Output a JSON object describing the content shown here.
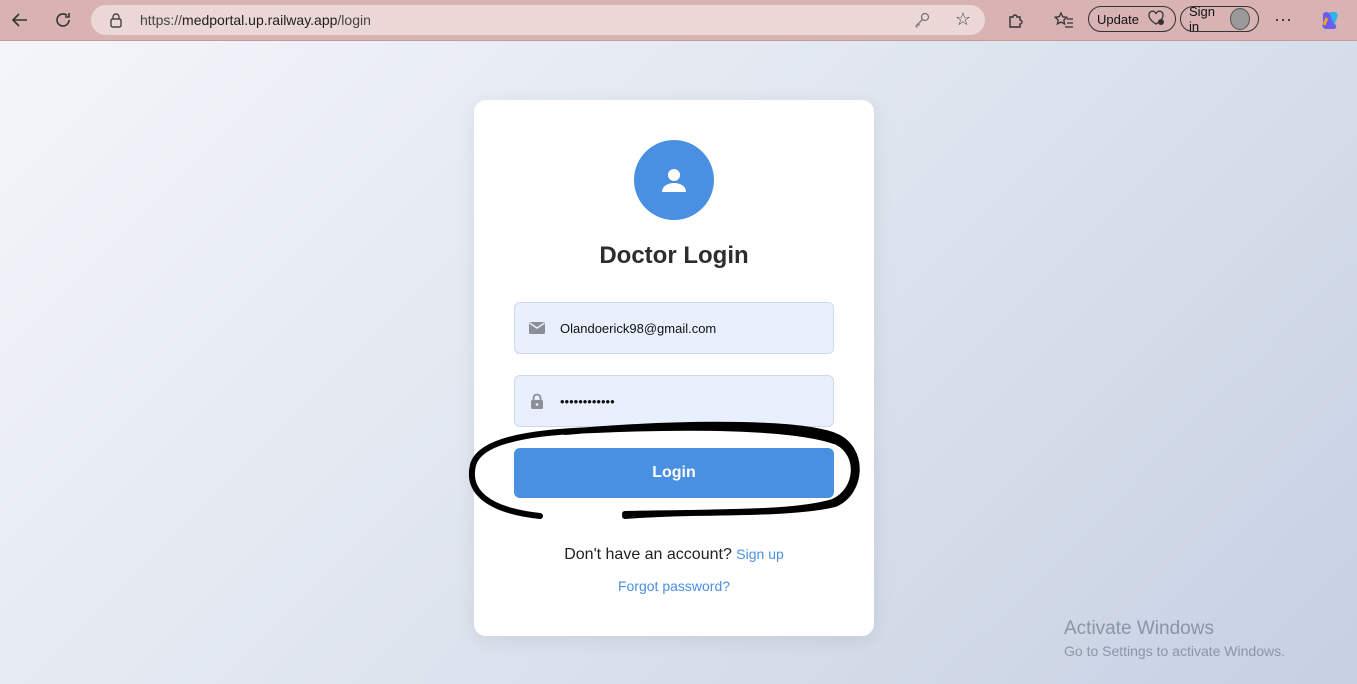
{
  "browser": {
    "url_prefix": "https://",
    "url_host": "medportal.up.railway.app",
    "url_path": "/login",
    "update_label": "Update",
    "signin_label": "Sign in"
  },
  "login": {
    "title": "Doctor Login",
    "email_value": "Olandoerick98@gmail.com",
    "password_value": "••••••••••••",
    "button_label": "Login",
    "signup_prompt": "Don't have an account?",
    "signup_link": "Sign up",
    "forgot_link": "Forgot password?"
  },
  "watermark": {
    "title": "Activate Windows",
    "subtitle": "Go to Settings to activate Windows."
  },
  "colors": {
    "accent": "#4a90e2",
    "toolbar": "#d9b3b3"
  }
}
